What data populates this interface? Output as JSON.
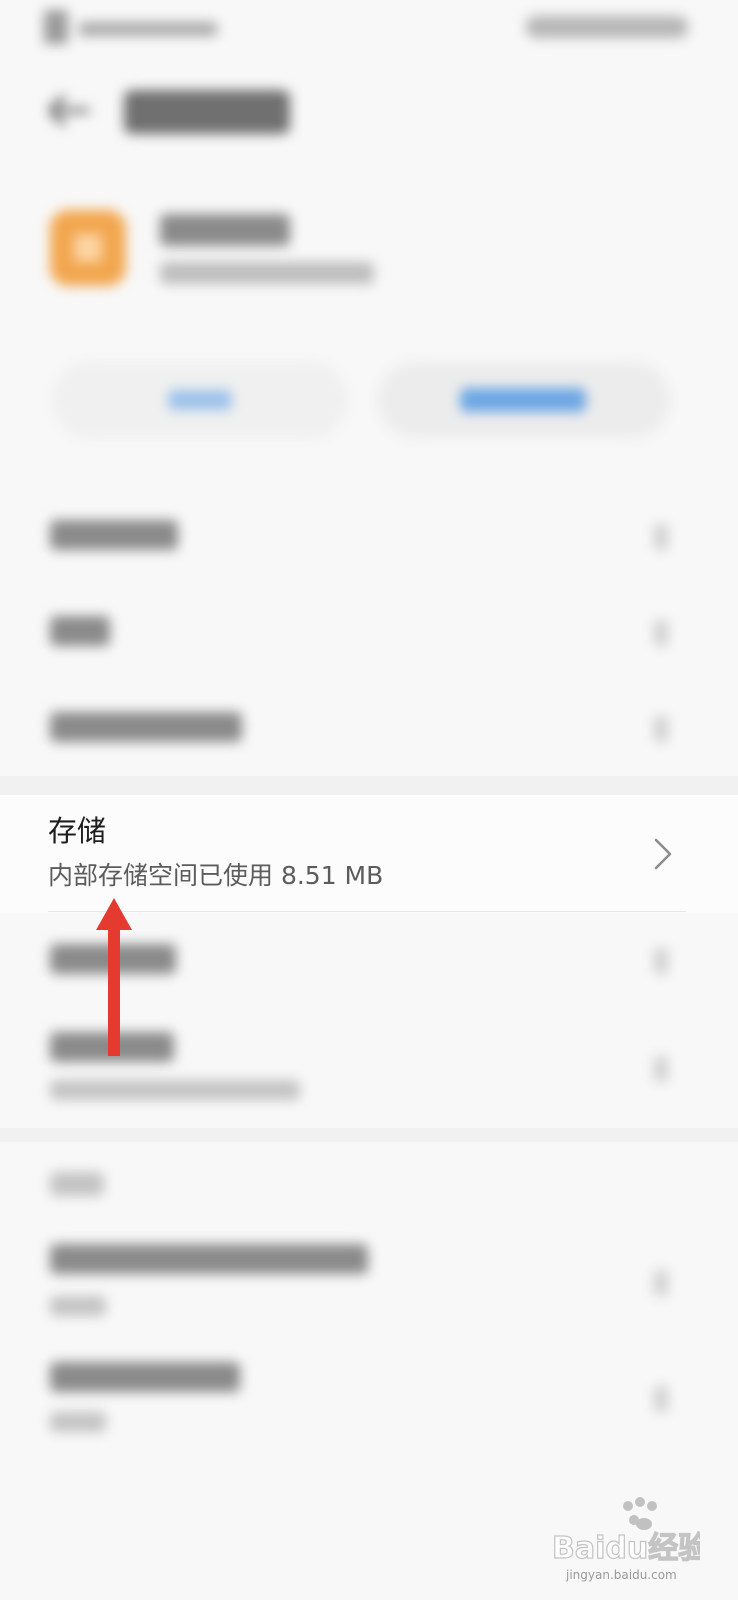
{
  "storage": {
    "title": "存储",
    "subtitle": "内部存储空间已使用 8.51 MB"
  },
  "watermark": {
    "logo_text": "Baidu经验",
    "url": "jingyan.baidu.com"
  },
  "colors": {
    "accent_blue": "#4a90e2",
    "app_icon_orange": "#f2a64e",
    "annotation_red": "#e53a2f",
    "background": "#f8f8f8"
  },
  "icons": {
    "back": "back-arrow-icon",
    "chevron": "chevron-right-icon",
    "annotation": "red-up-arrow-annotation"
  }
}
